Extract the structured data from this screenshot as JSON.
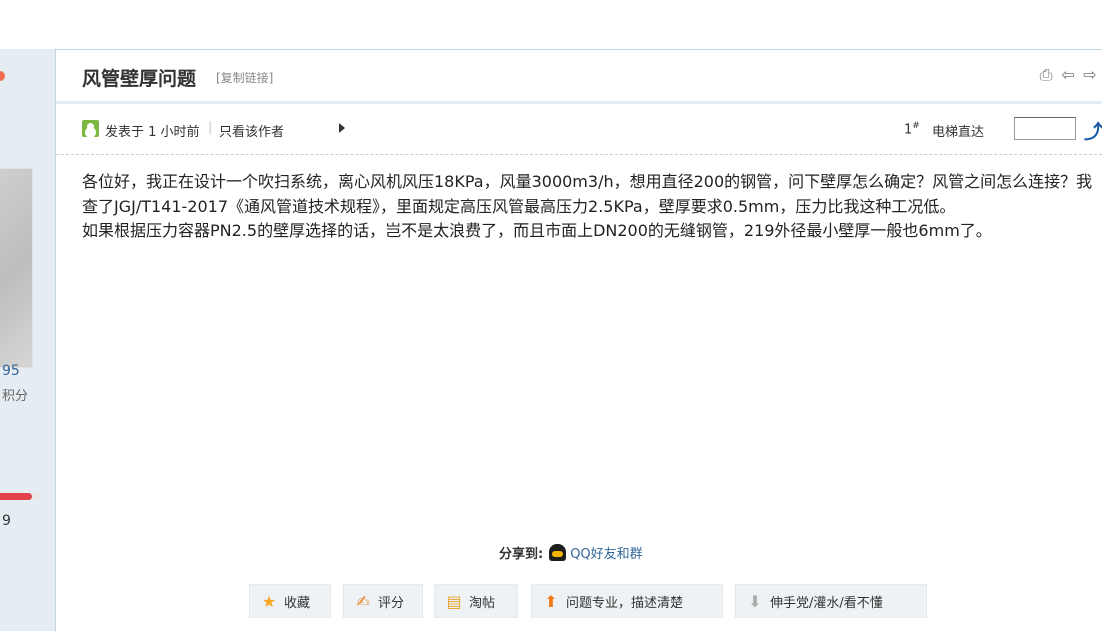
{
  "left_panel": {
    "stat_number": "95",
    "stat_sub": "积分",
    "progress_fraction": 0.8,
    "count": "9"
  },
  "thread": {
    "title": "风管壁厚问题",
    "copy_link": "[复制链接]",
    "icons": [
      "print-icon",
      "prev-thread-icon",
      "next-thread-icon"
    ]
  },
  "meta": {
    "posted": "发表于 1 小时前",
    "separator": "|",
    "author_only": "只看该作者",
    "floor": "1",
    "floor_sup": "#",
    "elevator": "电梯直达"
  },
  "post": {
    "paragraphs": [
      "各位好，我正在设计一个吹扫系统，离心风机风压18KPa，风量3000m3/h，想用直径200的钢管，问下壁厚怎么确定？风管之间怎么连接？我查了JGJ/T141-2017《通风管道技术规程》，里面规定高压风管最高压力2.5KPa，壁厚要求0.5mm，压力比我这种工况低。",
      "如果根据压力容器PN2.5的壁厚选择的话，岂不是太浪费了，而且市面上DN200的无缝钢管，219外径最小壁厚一般也6mm了。"
    ]
  },
  "share": {
    "label": "分享到:",
    "qq": "QQ好友和群"
  },
  "actions": {
    "favorite": "收藏",
    "rate": "评分",
    "tao": "淘帖",
    "good": "问题专业，描述清楚",
    "bad": "伸手党/灌水/看不懂"
  },
  "colors": {
    "border": "#c2d5e3",
    "link": "#336699",
    "button_bg": "#eef2f5"
  }
}
